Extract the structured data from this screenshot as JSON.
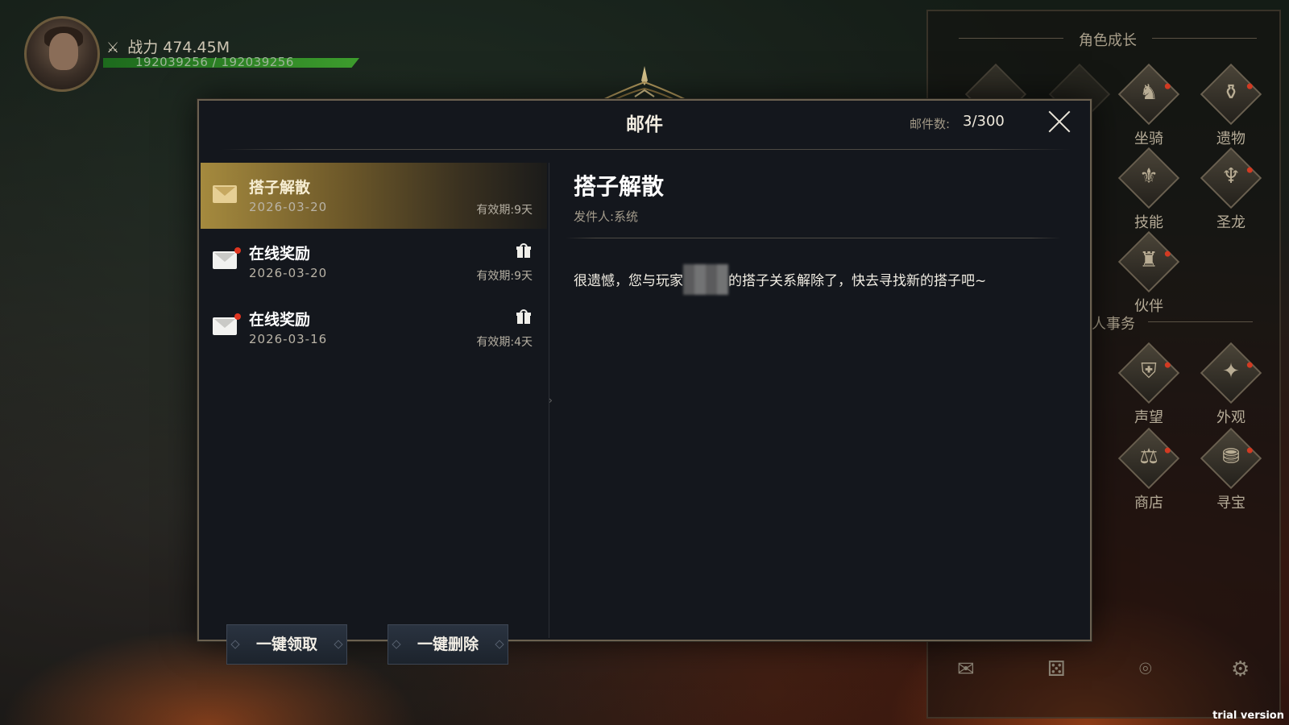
{
  "player": {
    "power_label": "战力",
    "power_value": "474.45M",
    "hp_text": "192039256 / 192039256",
    "avatar_icon": "portrait-icon",
    "power_icon": "crossed-swords-icon"
  },
  "side_panel": {
    "title": "角色成长",
    "section_2_title": "人事务",
    "features": [
      {
        "label": "坐骑",
        "icon": "horse-icon"
      },
      {
        "label": "遗物",
        "icon": "relic-icon"
      },
      {
        "label": "技能",
        "icon": "sword-icon"
      },
      {
        "label": "圣龙",
        "icon": "dragon-icon"
      },
      {
        "label": "伙伴",
        "icon": "helmet-icon"
      },
      {
        "label": "声望",
        "icon": "shield-icon"
      },
      {
        "label": "外观",
        "icon": "wand-icon"
      },
      {
        "label": "商店",
        "icon": "shop-icon"
      },
      {
        "label": "寻宝",
        "icon": "treasure-chest-icon"
      }
    ],
    "bottom_icons": [
      "mail-icon",
      "dice-icon",
      "camera-icon",
      "settings-icon"
    ]
  },
  "mail_window": {
    "title": "邮件",
    "count_label": "邮件数:",
    "count_value": "3/300",
    "mails": [
      {
        "title": "搭子解散",
        "date": "2026-03-20",
        "expiry": "有效期:9天",
        "selected": true,
        "has_gift": false,
        "read": true
      },
      {
        "title": "在线奖励",
        "date": "2026-03-20",
        "expiry": "有效期:9天",
        "selected": false,
        "has_gift": true,
        "read": false
      },
      {
        "title": "在线奖励",
        "date": "2026-03-16",
        "expiry": "有效期:4天",
        "selected": false,
        "has_gift": true,
        "read": false
      }
    ],
    "claim_all_label": "一键领取",
    "delete_all_label": "一键删除",
    "detail": {
      "title": "搭子解散",
      "sender": "发件人:系统",
      "body_prefix": "很遗憾，您与玩家",
      "body_suffix": "的搭子关系解除了，快去寻找新的搭子吧~"
    }
  },
  "watermark": "trial version",
  "colors": {
    "selected_mail_gold": "#a58a3e",
    "modal_bg": "#14171d",
    "unread_dot": "#e03520",
    "hp_green": "#3e9e2e"
  }
}
